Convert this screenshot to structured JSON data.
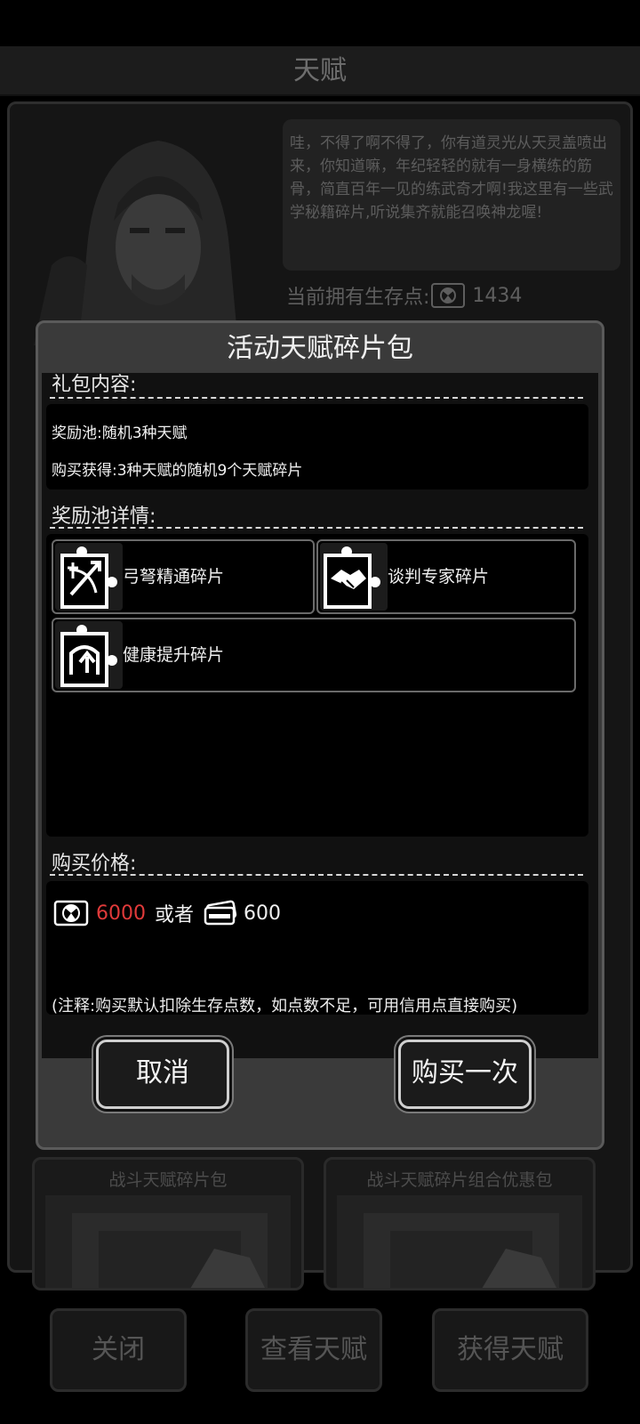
{
  "background": {
    "header_title": "天赋",
    "npc_dialog": "哇，不得了啊不得了，你有道灵光从天灵盖喷出来，你知道嘛，年纪轻轻的就有一身横练的筋骨，简直百年一见的练武奇才啊!我这里有一些武学秘籍碎片,听说集齐就能召唤神龙喔!",
    "points_label": "当前拥有生存点:",
    "points_value": "1434",
    "cards": [
      {
        "title": "战斗天赋碎片包"
      },
      {
        "title": "战斗天赋碎片组合优惠包"
      }
    ],
    "buttons": {
      "close": "关闭",
      "view": "查看天赋",
      "obtain": "获得天赋"
    }
  },
  "modal": {
    "title": "活动天赋碎片包",
    "contents_label": "礼包内容:",
    "pool_line": "奖励池:随机3种天赋",
    "reward_line": "购买获得:3种天赋的随机9个天赋碎片",
    "pool_detail_label": "奖励池详情:",
    "pool_items": [
      {
        "name": "弓弩精通碎片",
        "icon": "crossbow-icon"
      },
      {
        "name": "谈判专家碎片",
        "icon": "handshake-icon"
      },
      {
        "name": "健康提升碎片",
        "icon": "health-up-icon"
      }
    ],
    "price_label": "购买价格:",
    "price_survival": "6000",
    "price_or": "或者",
    "price_credit": "600",
    "note": "(注释:购买默认扣除生存点数，如点数不足，可用信用点直接购买)",
    "cancel_label": "取消",
    "buy_label": "购买一次"
  },
  "colors": {
    "price_red": "#e03a3a",
    "modal_bg": "#3a3a3a",
    "body_bg": "#111111"
  }
}
